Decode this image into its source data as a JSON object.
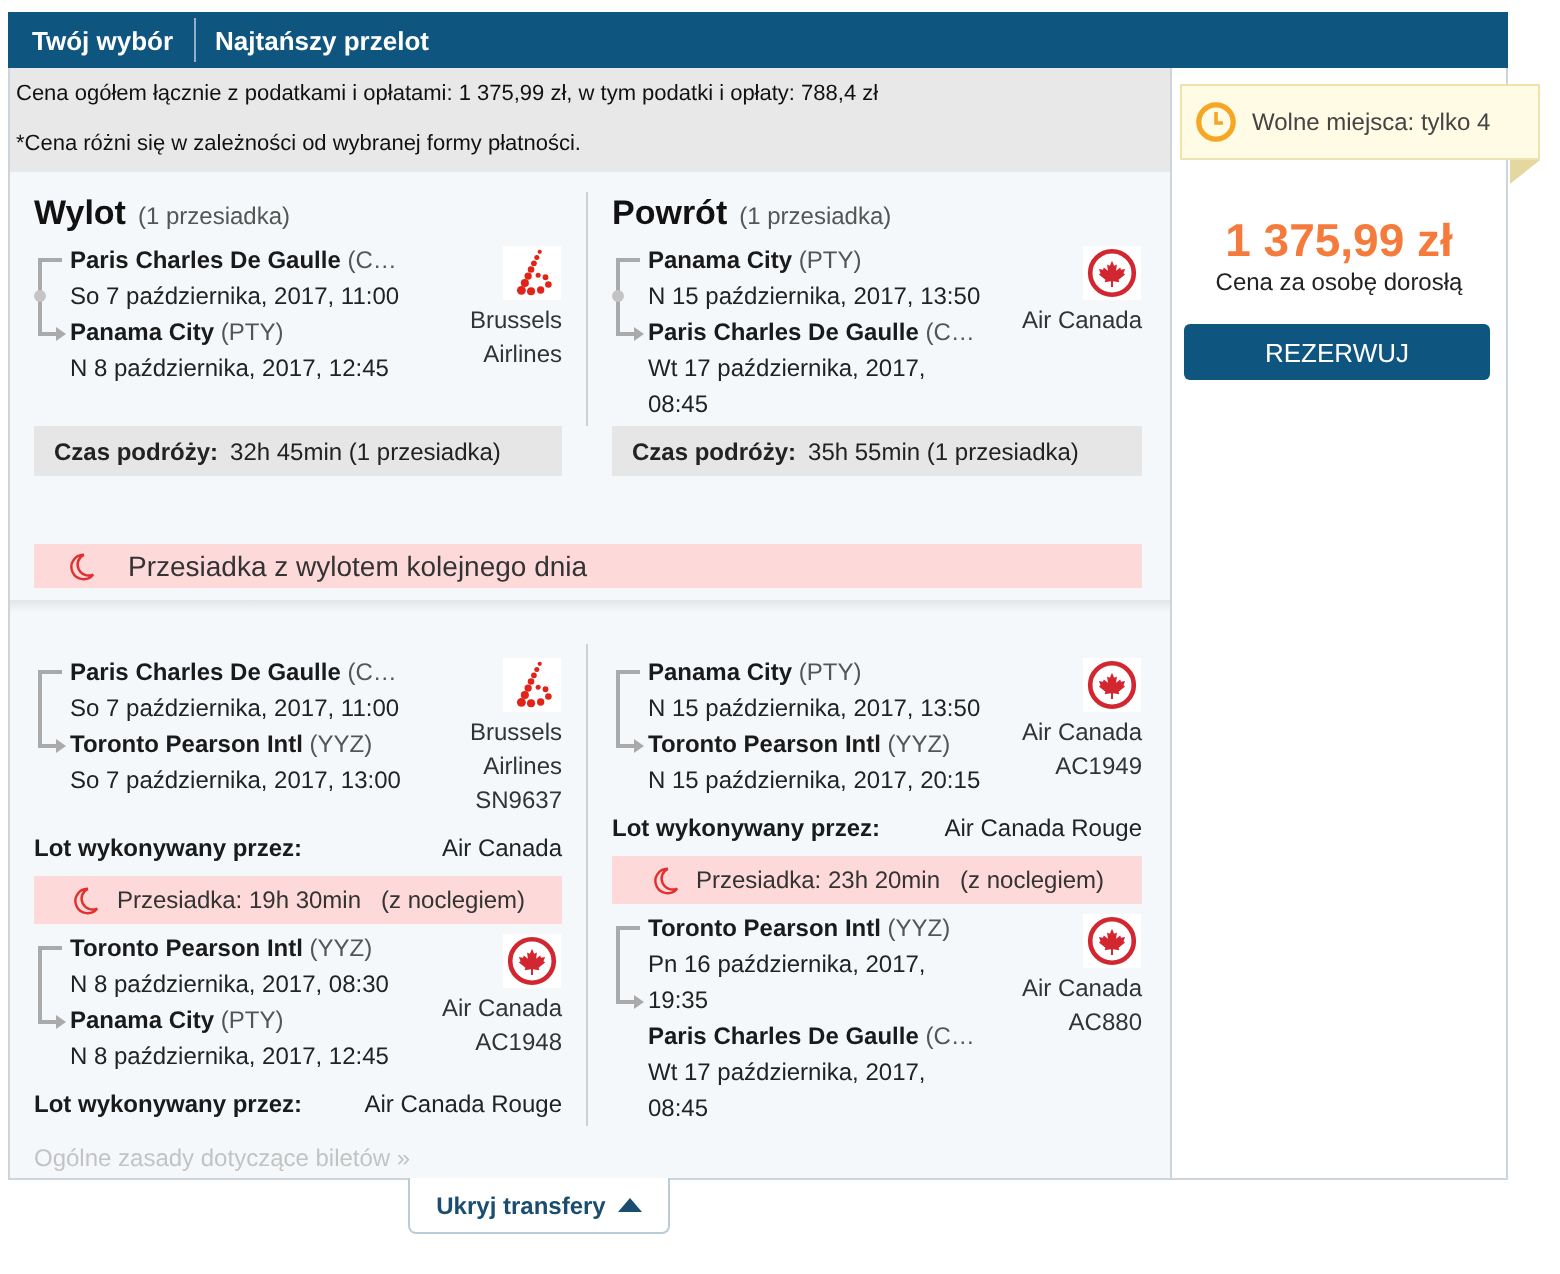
{
  "header": {
    "title": "Twój wybór",
    "subtitle": "Najtańszy przelot"
  },
  "price_info": {
    "total": "Cena ogółem łącznie z podatkami i opłatami: 1 375,99 zł, w tym podatki i opłaty: 788,4 zł",
    "note": "*Cena różni się w zależności od wybranej formy płatności."
  },
  "offer": {
    "availability": "Wolne miejsca: tylko 4",
    "price": "1 375,99 zł",
    "price_caption": "Cena za osobę dorosłą",
    "book_button": "REZERWUJ"
  },
  "summary": {
    "legs": [
      {
        "title": "Wylot",
        "stops": "(1 przesiadka)",
        "from": {
          "name": "Paris Charles De Gaulle",
          "code": "(C…",
          "time": "So 7 października, 2017, 11:00"
        },
        "to": {
          "name": "Panama City",
          "code": "(PTY)",
          "time": "N 8 października, 2017, 12:45"
        },
        "airline": {
          "kind": "dots",
          "name": "Brussels Airlines"
        },
        "duration_label": "Czas podróży:",
        "duration": "32h 45min (1 przesiadka)"
      },
      {
        "title": "Powrót",
        "stops": "(1 przesiadka)",
        "from": {
          "name": "Panama City",
          "code": "(PTY)",
          "time": "N 15 października, 2017, 13:50"
        },
        "to": {
          "name": "Paris Charles De Gaulle",
          "code": "(C…",
          "time": "Wt 17 października, 2017, 08:45"
        },
        "airline": {
          "kind": "leaf",
          "name": "Air Canada"
        },
        "duration_label": "Czas podróży:",
        "duration": "35h 55min (1 przesiadka)"
      }
    ],
    "alert": "Przesiadka z wylotem kolejnego dnia"
  },
  "details": {
    "columns": [
      {
        "items": [
          {
            "kind": "segment",
            "from": {
              "name": "Paris Charles De Gaulle",
              "code": "(C…",
              "time": "So 7 października, 2017, 11:00"
            },
            "to": {
              "name": "Toronto Pearson Intl",
              "code": "(YYZ)",
              "time": "So 7 października, 2017, 13:00"
            },
            "airline": {
              "kind": "dots",
              "name": "Brussels Airlines"
            },
            "flight": "SN9637"
          },
          {
            "kind": "operator",
            "label": "Lot wykonywany przez:",
            "value": "Air Canada"
          },
          {
            "kind": "layover",
            "label": "Przesiadka: 19h 30min",
            "note": "(z noclegiem)"
          },
          {
            "kind": "segment",
            "from": {
              "name": "Toronto Pearson Intl",
              "code": "(YYZ)",
              "time": "N 8 października, 2017, 08:30"
            },
            "to": {
              "name": "Panama City",
              "code": "(PTY)",
              "time": "N 8 października, 2017, 12:45"
            },
            "airline": {
              "kind": "leaf",
              "name": "Air Canada"
            },
            "flight": "AC1948"
          },
          {
            "kind": "operator",
            "label": "Lot wykonywany przez:",
            "value": "Air Canada Rouge"
          }
        ]
      },
      {
        "items": [
          {
            "kind": "segment",
            "from": {
              "name": "Panama City",
              "code": "(PTY)",
              "time": "N 15 października, 2017, 13:50"
            },
            "to": {
              "name": "Toronto Pearson Intl",
              "code": "(YYZ)",
              "time": "N 15 października, 2017, 20:15"
            },
            "airline": {
              "kind": "leaf",
              "name": "Air Canada"
            },
            "flight": "AC1949"
          },
          {
            "kind": "operator",
            "label": "Lot wykonywany przez:",
            "value": "Air Canada Rouge"
          },
          {
            "kind": "layover",
            "label": "Przesiadka: 23h 20min",
            "note": "(z noclegiem)"
          },
          {
            "kind": "segment",
            "from": {
              "name": "Toronto Pearson Intl",
              "code": "(YYZ)",
              "time": "Pn 16 października, 2017, 19:35"
            },
            "to": {
              "name": "Paris Charles De Gaulle",
              "code": "(C…",
              "time": "Wt 17 października, 2017, 08:45"
            },
            "airline": {
              "kind": "leaf",
              "name": "Air Canada"
            },
            "flight": "AC880"
          }
        ]
      }
    ]
  },
  "footer": {
    "rules_link": "Ogólne zasady dotyczące biletów »",
    "toggle": {
      "label": "Ukryj transfery",
      "expanded": true
    }
  }
}
